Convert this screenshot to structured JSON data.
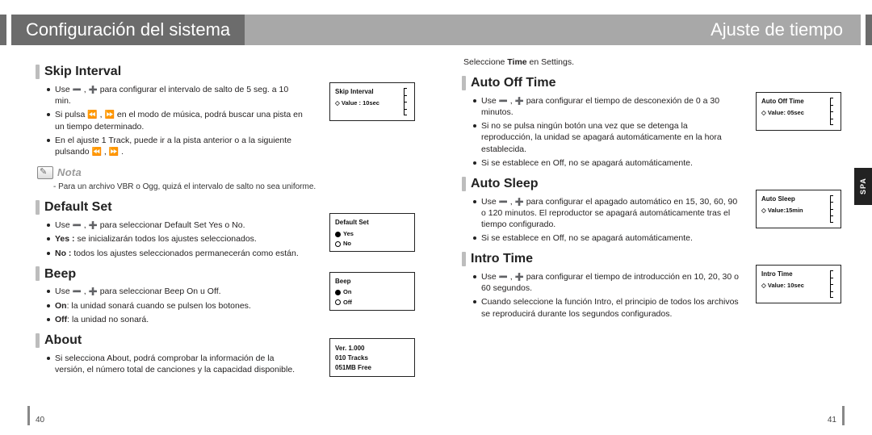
{
  "header": {
    "left_title": "Configuración del sistema",
    "right_title": "Ajuste de tiempo"
  },
  "spa_tab": "SPA",
  "page_numbers": {
    "left": "40",
    "right": "41"
  },
  "right_intro": {
    "pre": "Seleccione ",
    "bold": "Time",
    "post": " en Settings."
  },
  "left": {
    "skip": {
      "title": "Skip Interval",
      "b1_a": "Use ",
      "b1_b": " , ",
      "b1_c": " para configurar el intervalo de salto de 5 seg. a 10 min.",
      "b2_a": "Si pulsa ",
      "b2_b": " , ",
      "b2_c": " en el modo de música, podrá buscar una pista en un tiempo determinado.",
      "b3_a": "En el ajuste 1 Track, puede ir a la pista anterior o a la siguiente pulsando ",
      "b3_b": " , ",
      "b3_c": " .",
      "note_label": "Nota",
      "note_line": "- Para un archivo VBR o Ogg, quizá el intervalo de salto no sea uniforme.",
      "mini": {
        "title": "Skip Interval",
        "value": "Value : 10sec"
      }
    },
    "default": {
      "title": "Default Set",
      "b1_a": "Use ",
      "b1_b": " , ",
      "b1_c": " para seleccionar Default Set Yes o No.",
      "b2": "Yes : se inicializarán todos los ajustes seleccionados.",
      "b3": "No : todos los ajustes seleccionados permanecerán como están.",
      "mini": {
        "title": "Default Set",
        "opt1": "Yes",
        "opt2": "No"
      }
    },
    "beep": {
      "title": "Beep",
      "b1_a": "Use ",
      "b1_b": " , ",
      "b1_c": " para seleccionar Beep On u Off.",
      "b2": "On: la unidad sonará cuando se pulsen los botones.",
      "b3": "Off: la unidad no sonará.",
      "mini": {
        "title": "Beep",
        "opt1": "On",
        "opt2": "Off"
      }
    },
    "about": {
      "title": "About",
      "b1": "Si selecciona About, podrá comprobar la información de la versión, el número total de canciones y la capacidad disponible.",
      "mini": {
        "l1": "Ver.  1.000",
        "l2": "010 Tracks",
        "l3": "051MB Free"
      }
    }
  },
  "right": {
    "autooff": {
      "title": "Auto Off Time",
      "b1_a": "Use ",
      "b1_b": " , ",
      "b1_c": " para configurar el tiempo de desconexión de 0 a 30 minutos.",
      "b2": "Si no se pulsa ningún botón una vez que se detenga la reproducción, la unidad se apagará automáticamente en la hora establecida.",
      "b3": "Si se establece en Off, no se apagará automáticamente.",
      "mini": {
        "title": "Auto Off Time",
        "value": "Value: 05sec"
      }
    },
    "autosleep": {
      "title": "Auto Sleep",
      "b1_a": "Use ",
      "b1_b": " , ",
      "b1_c": " para configurar el apagado automático en 15, 30, 60, 90 o 120 minutos. El reproductor se apagará automáticamente tras el tiempo configurado.",
      "b2": "Si se establece en Off, no se apagará automáticamente.",
      "mini": {
        "title": "Auto Sleep",
        "value": "Value:15min"
      }
    },
    "intro": {
      "title": "Intro Time",
      "b1_a": "Use ",
      "b1_b": " , ",
      "b1_c": " para configurar el tiempo de introducción en 10, 20, 30 o 60 segundos.",
      "b2": "Cuando seleccione la función Intro, el principio de todos los archivos se reproducirá durante los segundos configurados.",
      "mini": {
        "title": "Intro Time",
        "value": "Value: 10sec"
      }
    }
  }
}
